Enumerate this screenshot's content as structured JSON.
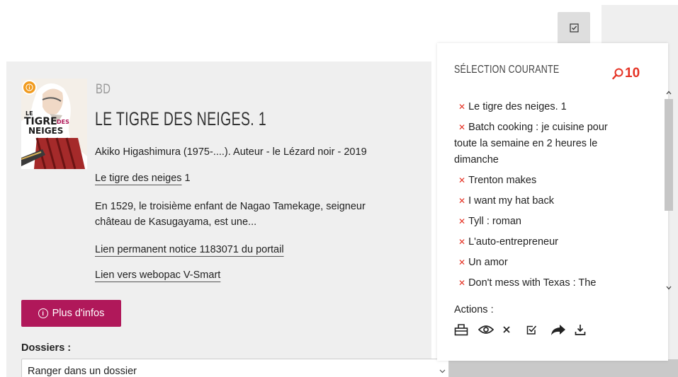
{
  "record": {
    "doc_type": "BD",
    "title": "LE TIGRE DES NEIGES. 1",
    "authors_line": "Akiko Higashimura (1975-....). Auteur - le Lézard noir - 2019",
    "series_link": "Le tigre des neiges",
    "series_number": " 1",
    "description_line1": "En 1529, le troisième enfant de Nagao Tamekage, seigneur",
    "description_line2": "château de Kasugayama, est une...",
    "permalink": "Lien permanent notice 1183071 du portail",
    "webopac_link": "Lien vers webopac V-Smart",
    "more_button": "Plus d'infos",
    "cover_title_lines": [
      "LE",
      "TIGRE",
      "DES",
      "NEIGES"
    ]
  },
  "folders": {
    "label": "Dossiers :",
    "select_value": "Ranger dans un dossier"
  },
  "selection": {
    "title": "SÉLECTION COURANTE",
    "count": "10",
    "items": [
      "Le tigre des neiges. 1",
      "Batch cooking : je cuisine pour toute la semaine en 2 heures le dimanche",
      "Trenton makes",
      "I want my hat back",
      "Tyll : roman",
      "L'auto-entrepreneur",
      "Un amor",
      "Don't mess with Texas : The"
    ],
    "actions_label": "Actions :"
  },
  "colors": {
    "accent": "#b0185a",
    "remove": "#e53224",
    "badge": "#f19b1f"
  }
}
